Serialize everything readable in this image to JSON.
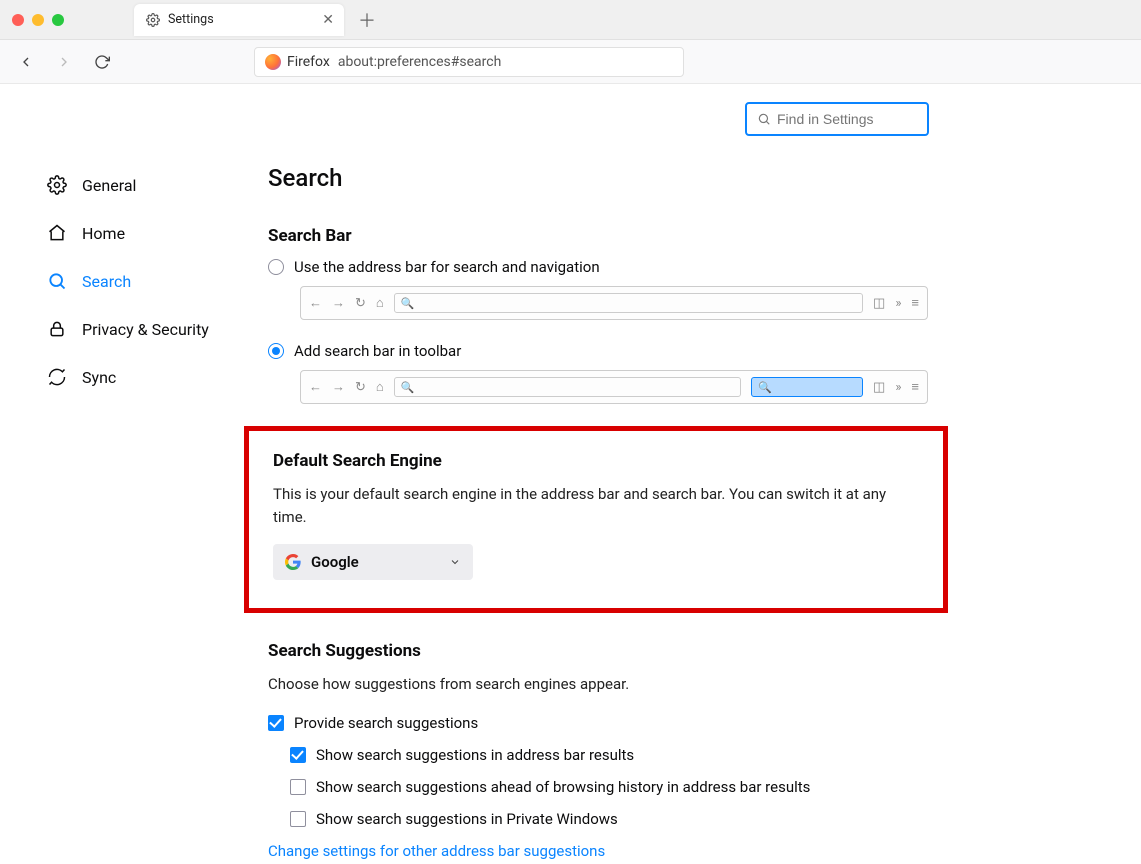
{
  "window": {
    "tab_label": "Settings"
  },
  "url": {
    "badge": "Firefox",
    "address": "about:preferences#search"
  },
  "find": {
    "placeholder": "Find in Settings"
  },
  "sidebar": {
    "items": [
      {
        "label": "General"
      },
      {
        "label": "Home"
      },
      {
        "label": "Search"
      },
      {
        "label": "Privacy & Security"
      },
      {
        "label": "Sync"
      }
    ],
    "active_index": 2
  },
  "page": {
    "title": "Search",
    "search_bar": {
      "heading": "Search Bar",
      "opt1": "Use the address bar for search and navigation",
      "opt2": "Add search bar in toolbar"
    },
    "default_engine": {
      "heading": "Default Search Engine",
      "desc": "This is your default search engine in the address bar and search bar. You can switch it at any time.",
      "selected": "Google"
    },
    "suggestions": {
      "heading": "Search Suggestions",
      "desc": "Choose how suggestions from search engines appear.",
      "c1": "Provide search suggestions",
      "c2": "Show search suggestions in address bar results",
      "c3": "Show search suggestions ahead of browsing history in address bar results",
      "c4": "Show search suggestions in Private Windows",
      "link": "Change settings for other address bar suggestions"
    }
  }
}
